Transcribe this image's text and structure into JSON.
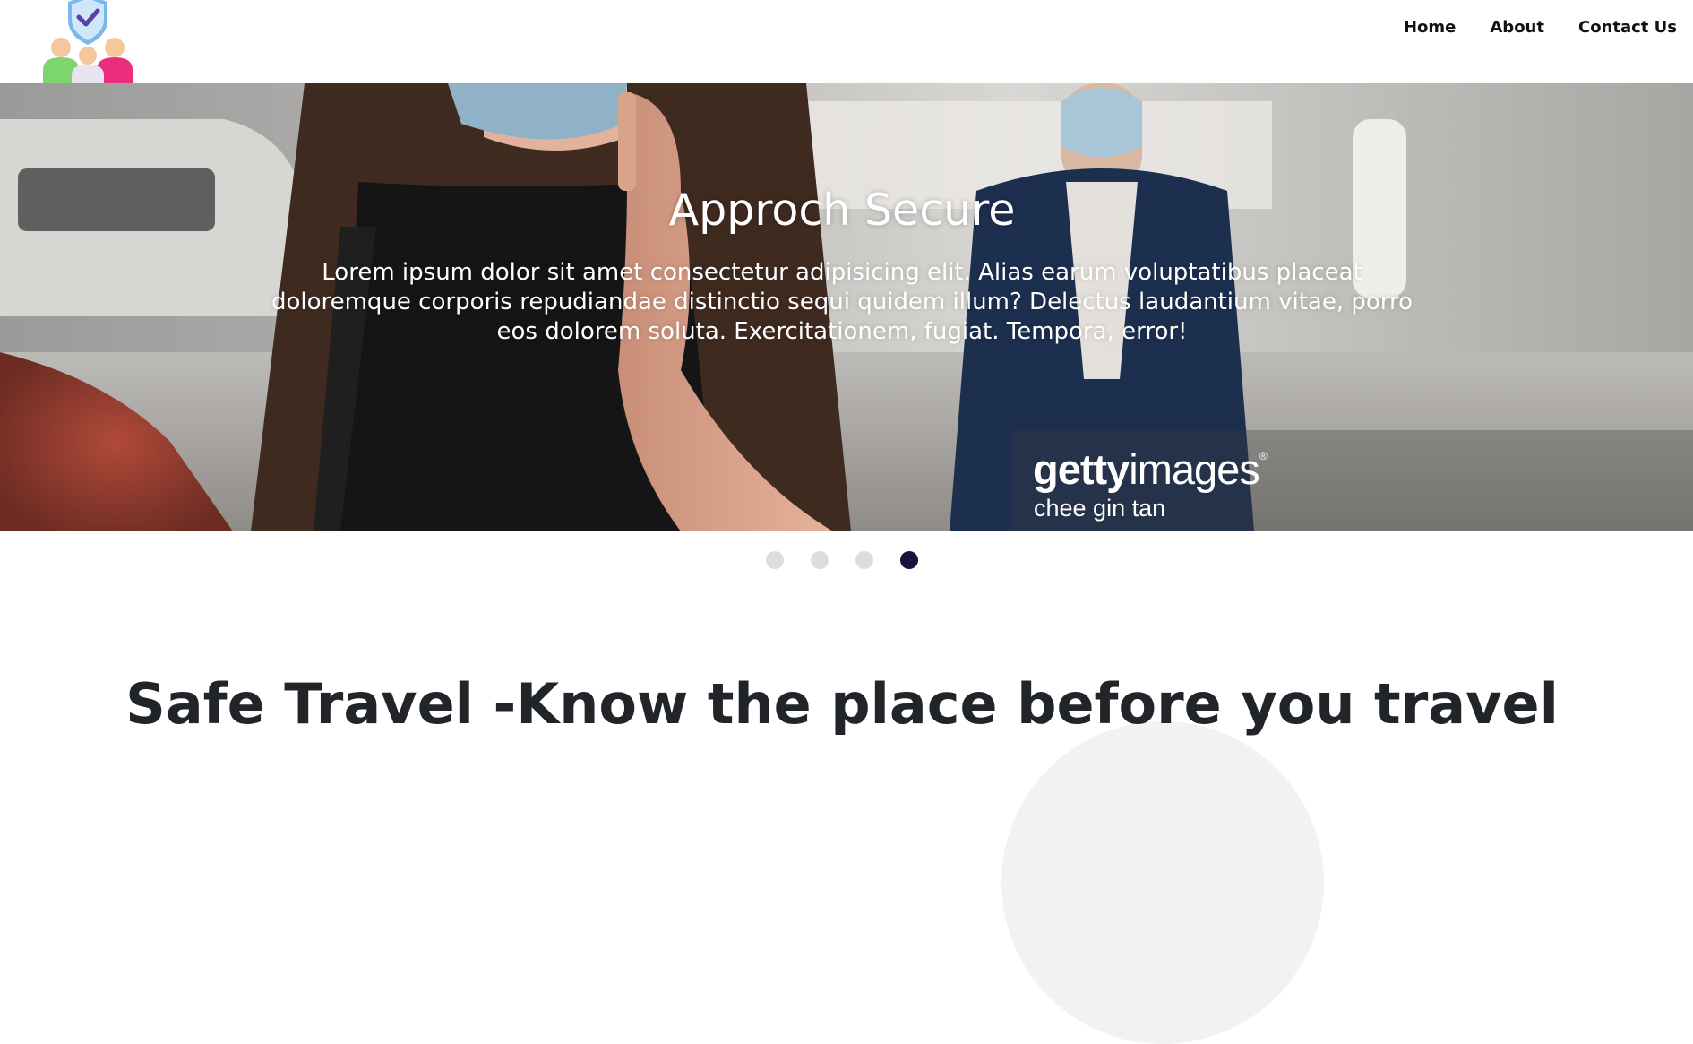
{
  "nav": {
    "links": [
      "Home",
      "About",
      "Contact Us"
    ]
  },
  "carousel": {
    "title": "Approch Secure",
    "text": "Lorem ipsum dolor sit amet consectetur adipisicing elit. Alias earum voluptatibus placeat doloremque corporis repudiandae distinctio sequi quidem illum? Delectus laudantium vitae, porro eos dolorem soluta. Exercitationem, fugiat. Tempora, error!",
    "watermark_brand_bold": "getty",
    "watermark_brand_light": "images",
    "watermark_reg": "®",
    "watermark_credit": "chee gin tan",
    "indicator_count": 4,
    "active_index": 3
  },
  "main": {
    "heading": "Safe Travel -Know the place before you travel"
  },
  "colors": {
    "indicator_active": "#14143f",
    "indicator_inactive": "#dddddd",
    "heading": "#212529"
  },
  "icons": {
    "logo": "shield-people-logo-icon"
  }
}
